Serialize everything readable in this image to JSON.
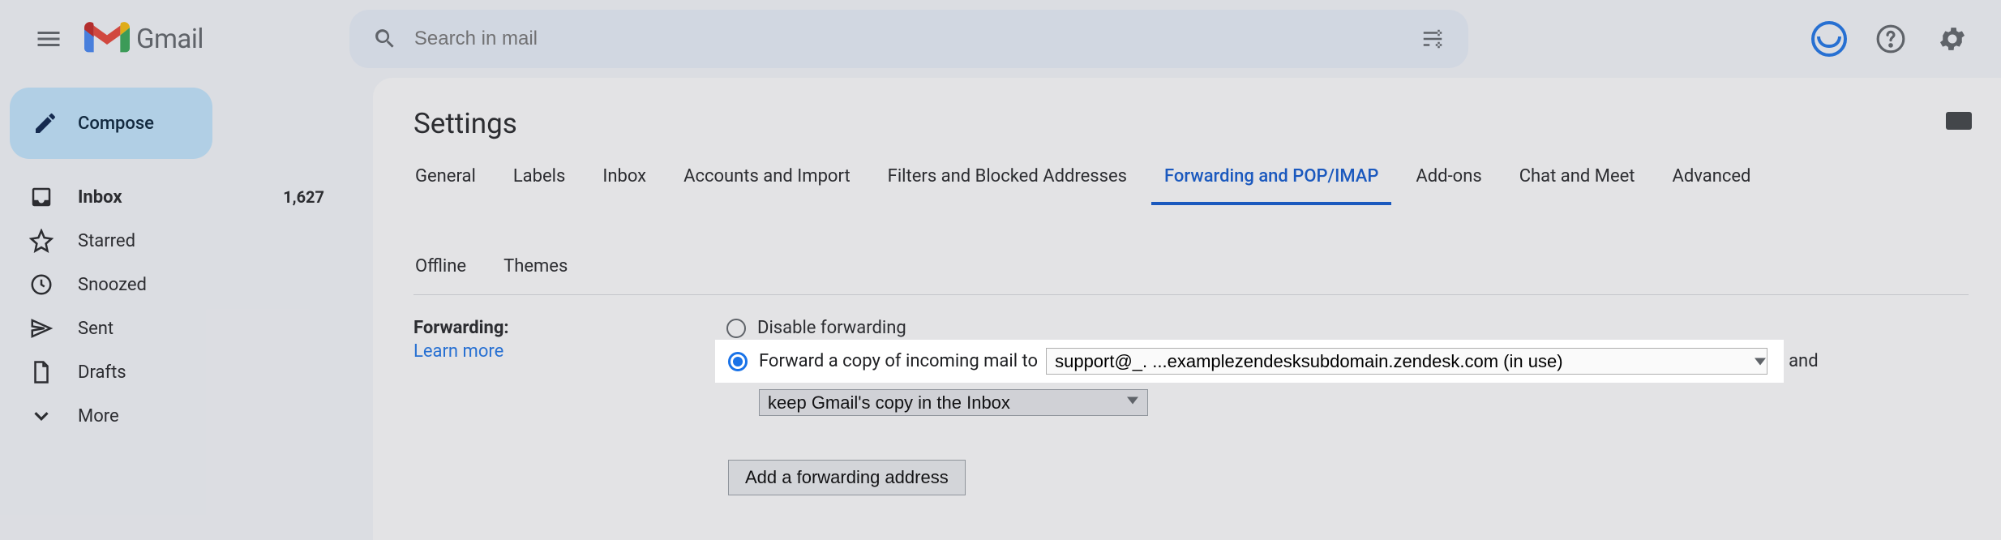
{
  "header": {
    "app_name": "Gmail",
    "search_placeholder": "Search in mail"
  },
  "sidebar": {
    "compose_label": "Compose",
    "items": [
      {
        "label": "Inbox",
        "count": "1,627"
      },
      {
        "label": "Starred"
      },
      {
        "label": "Snoozed"
      },
      {
        "label": "Sent"
      },
      {
        "label": "Drafts"
      },
      {
        "label": "More"
      }
    ]
  },
  "settings": {
    "title": "Settings",
    "tabs": [
      "General",
      "Labels",
      "Inbox",
      "Accounts and Import",
      "Filters and Blocked Addresses",
      "Forwarding and POP/IMAP",
      "Add-ons",
      "Chat and Meet",
      "Advanced",
      "Offline",
      "Themes"
    ],
    "active_tab_index": 5,
    "forwarding": {
      "section_label": "Forwarding:",
      "learn_more": "Learn more",
      "disable_label": "Disable forwarding",
      "forward_label_prefix": "Forward a copy of incoming mail to",
      "forward_address": "support@_. ...examplezendesksubdomain.zendesk.com (in use)",
      "trailing_and": "and",
      "copy_action": "keep Gmail's copy in the Inbox",
      "add_address_button": "Add a forwarding address",
      "selected_option": "forward"
    }
  }
}
